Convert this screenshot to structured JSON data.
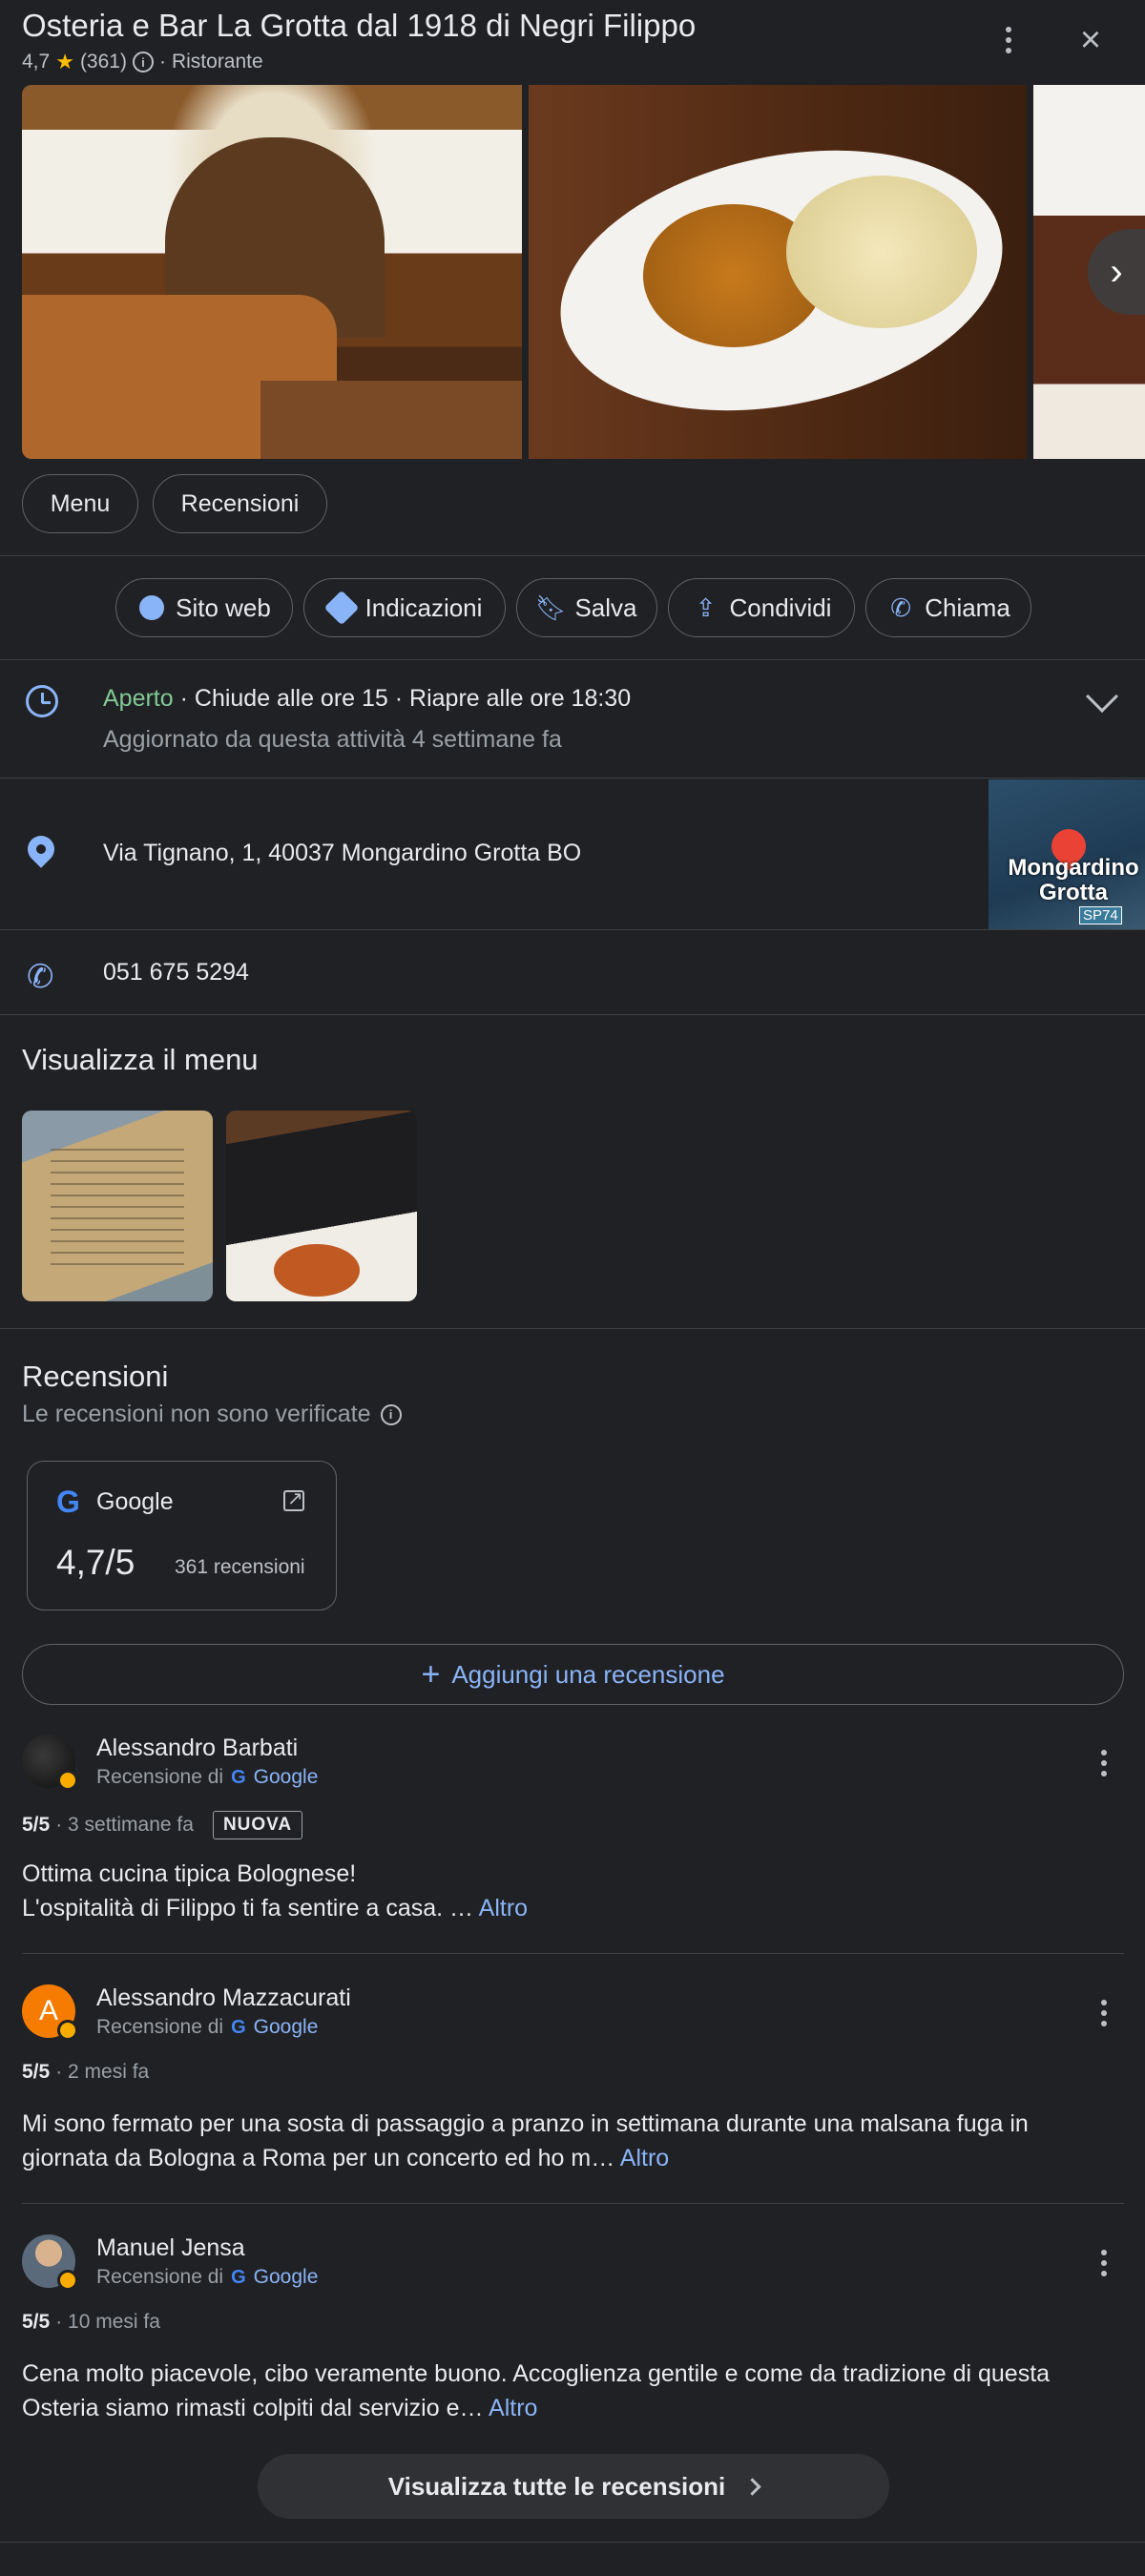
{
  "header": {
    "title": "Osteria e Bar La Grotta dal 1918 di Negri Filippo",
    "rating": "4,7",
    "review_count": "(361)",
    "separator": "·",
    "category": "Ristorante"
  },
  "tabs": [
    "Menu",
    "Recensioni"
  ],
  "actions": {
    "website": "Sito web",
    "directions": "Indicazioni",
    "save": "Salva",
    "share": "Condividi",
    "call": "Chiama"
  },
  "hours": {
    "status": "Aperto",
    "detail": " · Chiude alle ore 15 · Riapre alle ore 18:30",
    "updated": "Aggiornato da questa attività 4 settimane fa"
  },
  "address": {
    "text": "Via Tignano, 1, 40037 Mongardino Grotta BO",
    "map_label": "Mongardino Grotta",
    "road_label": "SP74"
  },
  "phone": "051 675 5294",
  "menu_section": {
    "title": "Visualizza il menu"
  },
  "reviews_section": {
    "title": "Recensioni",
    "subtitle": "Le recensioni non sono verificate",
    "source_name": "Google",
    "source_rating": "4,7/5",
    "source_count": "361 recensioni",
    "add_review": "Aggiungi una recensione",
    "review_from": "Recensione di",
    "more": "Altro",
    "see_all": "Visualizza tutte le recensioni"
  },
  "reviews": [
    {
      "author": "Alessandro Barbati",
      "score": "5/5",
      "when": "· 3 settimane fa",
      "badge": "NUOVA",
      "text": "Ottima cucina tipica Bolognese!\nL'ospitalità di Filippo ti fa sentire a casa. … "
    },
    {
      "author": "Alessandro Mazzacurati",
      "avatar_letter": "A",
      "score": "5/5",
      "when": "· 2 mesi fa",
      "text": "Mi sono fermato per una sosta di passaggio a pranzo in settimana durante una malsana fuga in giornata da Bologna a Roma per un concerto ed ho m… "
    },
    {
      "author": "Manuel Jensa",
      "score": "5/5",
      "when": "· 10 mesi fa",
      "text": "Cena molto piacevole, cibo veramente buono. Accoglienza gentile e come da tradizione di questa Osteria siamo rimasti colpiti dal servizio e… "
    }
  ],
  "colors": {
    "background": "#202124",
    "accent": "#8ab4f8",
    "open_green": "#81c995",
    "star": "#fbbc04"
  }
}
